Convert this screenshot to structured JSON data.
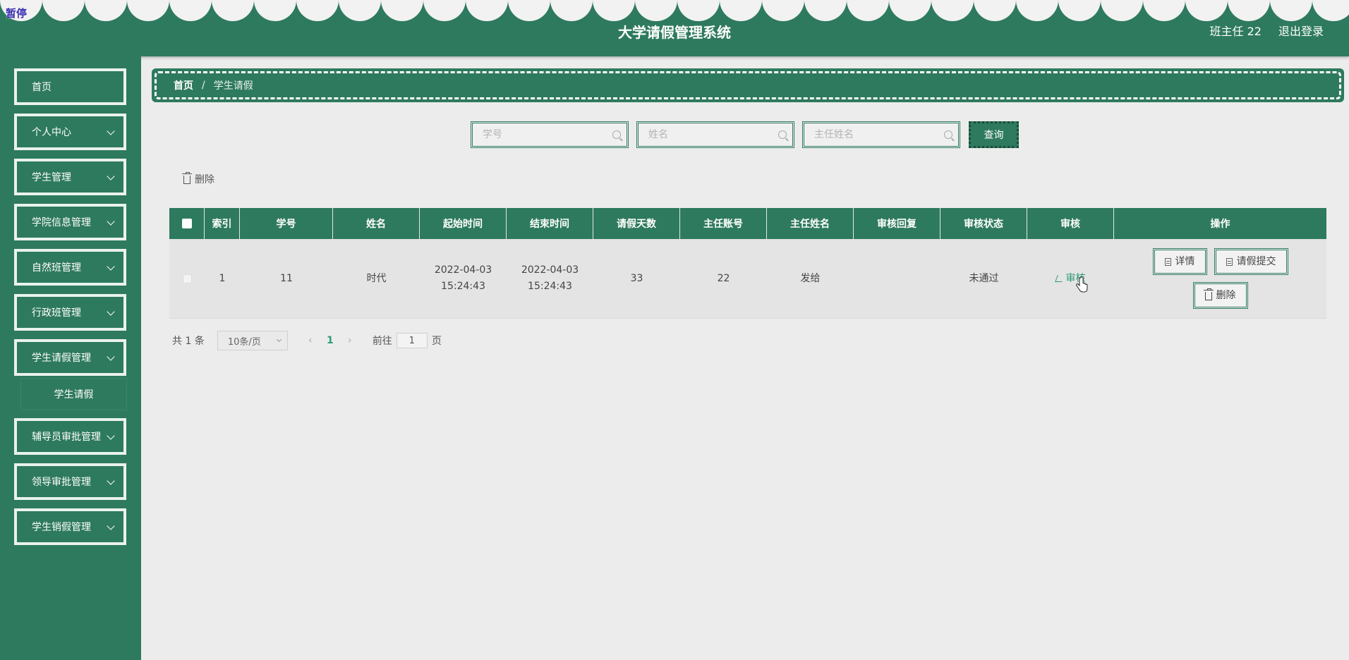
{
  "header": {
    "pause_label": "暂停",
    "title": "大学请假管理系统",
    "user": "班主任 22",
    "logout": "退出登录"
  },
  "sidebar": {
    "items": [
      {
        "label": "首页",
        "has_arrow": false
      },
      {
        "label": "个人中心",
        "has_arrow": true
      },
      {
        "label": "学生管理",
        "has_arrow": true
      },
      {
        "label": "学院信息管理",
        "has_arrow": true
      },
      {
        "label": "自然班管理",
        "has_arrow": true
      },
      {
        "label": "行政班管理",
        "has_arrow": true
      },
      {
        "label": "学生请假管理",
        "has_arrow": true
      },
      {
        "label": "辅导员审批管理",
        "has_arrow": true
      },
      {
        "label": "领导审批管理",
        "has_arrow": true
      },
      {
        "label": "学生销假管理",
        "has_arrow": true
      }
    ],
    "submenu": {
      "label": "学生请假"
    }
  },
  "breadcrumb": {
    "home": "首页",
    "separator": "/",
    "current": "学生请假"
  },
  "search": {
    "student_no_placeholder": "学号",
    "name_placeholder": "姓名",
    "teacher_name_placeholder": "主任姓名",
    "query_label": "查询"
  },
  "toolbar": {
    "delete_label": "删除"
  },
  "table": {
    "columns": [
      "索引",
      "学号",
      "姓名",
      "起始时间",
      "结束时间",
      "请假天数",
      "主任账号",
      "主任姓名",
      "审核回复",
      "审核状态",
      "审核",
      "操作"
    ],
    "rows": [
      {
        "index": "1",
        "student_no": "11",
        "name": "时代",
        "start_time": "2022-04-03 15:24:43",
        "end_time": "2022-04-03 15:24:43",
        "days": "33",
        "teacher_account": "22",
        "teacher_name": "发给",
        "reply": "",
        "status": "未通过",
        "audit_label": "审核",
        "ops": {
          "detail": "详情",
          "submit": "请假提交",
          "delete": "删除"
        }
      }
    ]
  },
  "pagination": {
    "total": "共 1 条",
    "page_size": "10条/页",
    "current_page": "1",
    "goto_prefix": "前往",
    "goto_value": "1",
    "goto_suffix": "页"
  },
  "colors": {
    "primary": "#2e7a5e",
    "content_bg": "#ececec",
    "link": "#2e9a78"
  }
}
